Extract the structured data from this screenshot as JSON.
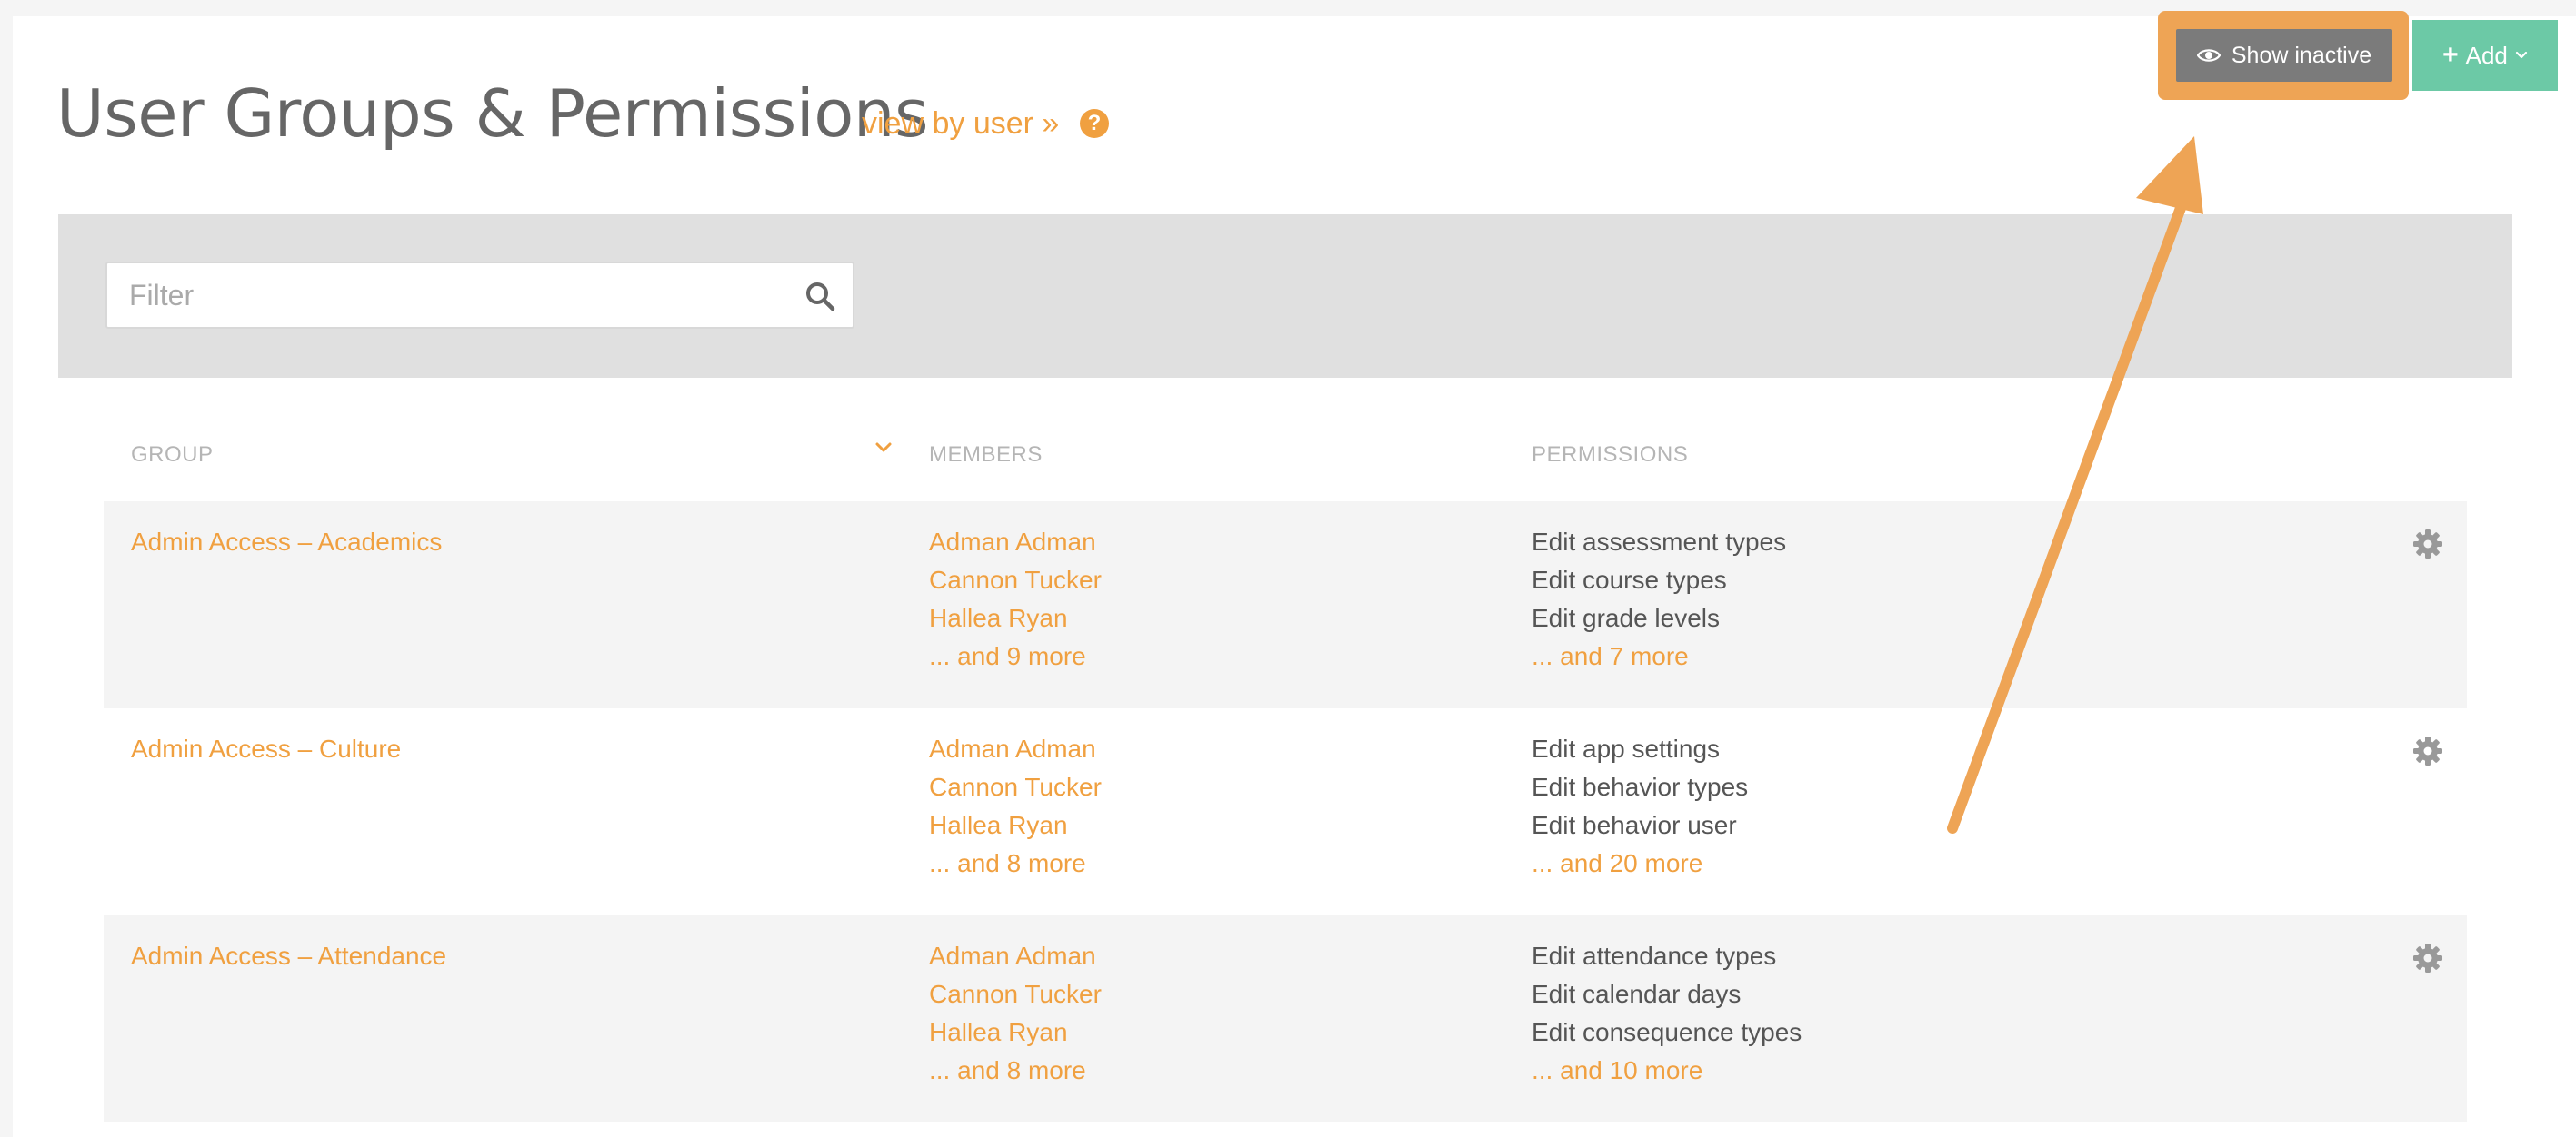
{
  "header": {
    "title": "User Groups & Permissions",
    "view_by_user_link": "view by user »",
    "help_glyph": "?"
  },
  "toolbar": {
    "show_inactive_label": "Show inactive",
    "add_label": "Add",
    "add_glyph": "+"
  },
  "filter": {
    "placeholder": "Filter",
    "value": ""
  },
  "table": {
    "columns": {
      "group": "GROUP",
      "members": "MEMBERS",
      "permissions": "PERMISSIONS"
    },
    "sort_column": "group",
    "rows": [
      {
        "group": "Admin Access – Academics",
        "members": [
          "Adman Adman",
          "Cannon Tucker",
          "Hallea Ryan"
        ],
        "members_more": "... and 9 more",
        "permissions": [
          "Edit assessment types",
          "Edit course types",
          "Edit grade levels"
        ],
        "permissions_more": "... and 7 more"
      },
      {
        "group": "Admin Access – Culture",
        "members": [
          "Adman Adman",
          "Cannon Tucker",
          "Hallea Ryan"
        ],
        "members_more": "... and 8 more",
        "permissions": [
          "Edit app settings",
          "Edit behavior types",
          "Edit behavior user"
        ],
        "permissions_more": "... and 20 more"
      },
      {
        "group": "Admin Access – Attendance",
        "members": [
          "Adman Adman",
          "Cannon Tucker",
          "Hallea Ryan"
        ],
        "members_more": "... and 8 more",
        "permissions": [
          "Edit attendance types",
          "Edit calendar days",
          "Edit consequence types"
        ],
        "permissions_more": "... and 10 more"
      }
    ]
  },
  "icons": {
    "help": "question-circle-icon",
    "search": "search-icon",
    "sort": "chevron-down-icon",
    "row_action": "gear-icon",
    "show_inactive": "eye-icon",
    "add": "plus-icon",
    "add_menu": "chevron-down-icon"
  },
  "colors": {
    "accent": "#f0a040",
    "add_button": "#6cc9a6",
    "show_inactive_button": "#7b7b7b",
    "annotation": "#eea455",
    "filter_band": "#e0e0e0",
    "row_shade": "#f4f4f4"
  }
}
